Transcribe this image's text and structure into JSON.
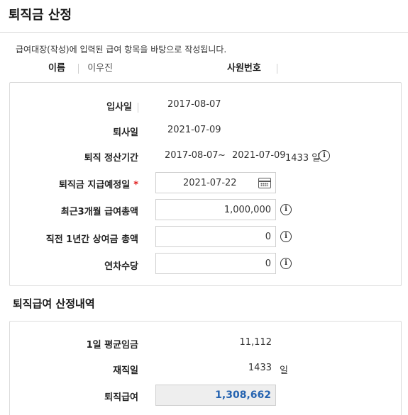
{
  "header": {
    "title": "퇴직금 산정"
  },
  "note": "급여대장(작성)에 입력된 급여 항목을 바탕으로 작성됩니다.",
  "employee": {
    "name_label": "이름",
    "name_value": "이우진",
    "id_label": "사원번호",
    "id_value": ""
  },
  "form": {
    "hire_date_label": "입사일",
    "hire_date": "2017-08-07",
    "retire_date_label": "퇴사일",
    "retire_date": "2021-07-09",
    "period_label": "퇴직 정산기간",
    "period_start": "2017-08-07",
    "period_tilde": "~",
    "period_end": "2021-07-09",
    "period_days": "1433 일",
    "pay_date_label": "퇴직금 지급예정일",
    "required_mark": "*",
    "pay_date_value": "2021-07-22",
    "salary3_label": "최근3개월 급여총액",
    "salary3_value": "1,000,000",
    "bonus_label": "직전 1년간 상여금 총액",
    "bonus_value": "0",
    "leave_label": "연차수당",
    "leave_value": "0",
    "info_glyph": "i"
  },
  "result": {
    "section_title": "퇴직급여 산정내역",
    "avg_wage_label": "1일 평균임금",
    "avg_wage_value": "11,112",
    "tenure_label": "재직일",
    "tenure_value": "1433",
    "tenure_unit": "일",
    "severance_label": "퇴직급여",
    "severance_value": "1,308,662"
  }
}
